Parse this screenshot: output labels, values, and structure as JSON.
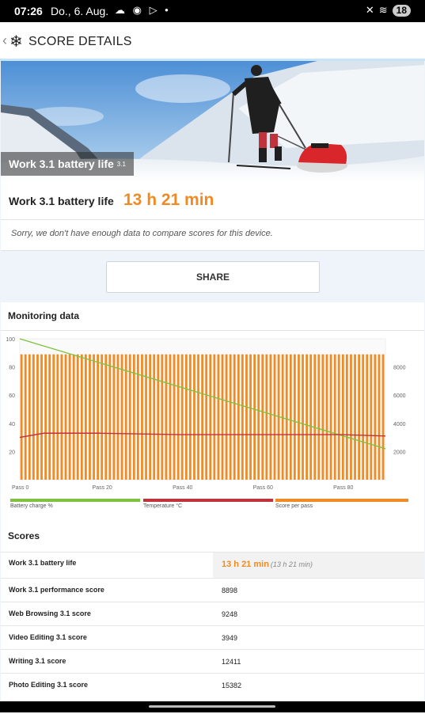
{
  "status_bar": {
    "time": "07:26",
    "date": "Do., 6. Aug.",
    "battery": "18"
  },
  "header": {
    "title": "SCORE DETAILS"
  },
  "hero": {
    "label": "Work 3.1 battery life",
    "version": "3.1"
  },
  "score": {
    "name": "Work 3.1 battery life",
    "value": "13 h 21 min",
    "note": "Sorry, we don't have enough data to compare scores for this device."
  },
  "share_button": "SHARE",
  "monitoring": {
    "title": "Monitoring data",
    "legend": [
      {
        "label": "Battery charge %",
        "color": "#7fc241"
      },
      {
        "label": "Temperature °C",
        "color": "#c0323c"
      },
      {
        "label": "Score per pass",
        "color": "#f08b24"
      }
    ]
  },
  "chart_data": {
    "type": "line",
    "x_tick_labels": [
      "Pass 0",
      "Pass 20",
      "Pass 40",
      "Pass 60",
      "Pass 80"
    ],
    "xlim": [
      0,
      91
    ],
    "left_axis": {
      "ticks": [
        20,
        40,
        60,
        80,
        100
      ],
      "ylim": [
        0,
        100
      ]
    },
    "right_axis": {
      "ticks": [
        2000,
        4000,
        6000,
        8000
      ],
      "ylim": [
        0,
        10000
      ]
    },
    "series": [
      {
        "name": "Battery charge %",
        "axis": "left",
        "color": "#7fc241",
        "start": 100,
        "end": 22
      },
      {
        "name": "Temperature °C",
        "axis": "left",
        "color": "#c0323c",
        "start": 30,
        "plateau": 33,
        "end": 30
      },
      {
        "name": "Score per pass",
        "axis": "right",
        "color": "#f08b24",
        "bars": 91,
        "value": 8898
      }
    ]
  },
  "scores": {
    "title": "Scores",
    "rows": [
      {
        "name": "Work 3.1 battery life",
        "value": "13 h 21 min",
        "sub": "(13 h 21 min)"
      },
      {
        "name": "Work 3.1 performance score",
        "value": "8898"
      },
      {
        "name": "Web Browsing 3.1 score",
        "value": "9248"
      },
      {
        "name": "Video Editing 3.1 score",
        "value": "3949"
      },
      {
        "name": "Writing 3.1 score",
        "value": "12411"
      },
      {
        "name": "Photo Editing 3.1 score",
        "value": "15382"
      }
    ]
  }
}
